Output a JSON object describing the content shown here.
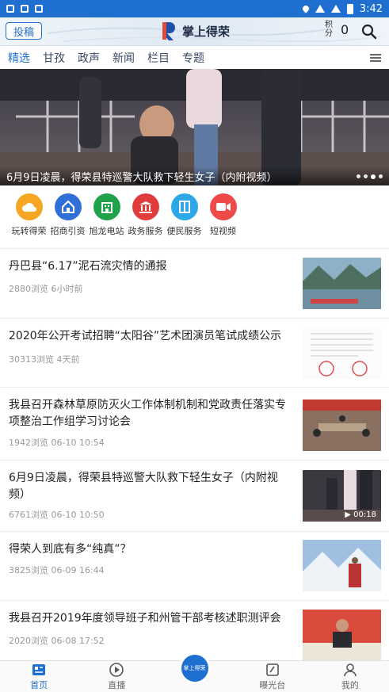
{
  "status_bar": {
    "time": "3:42"
  },
  "header": {
    "submit_label": "投稿",
    "app_name": "掌上得荣",
    "points_label": "积分",
    "points_value": "0"
  },
  "channels": [
    {
      "label": "精选",
      "active": true
    },
    {
      "label": "甘孜",
      "active": false
    },
    {
      "label": "政声",
      "active": false
    },
    {
      "label": "新闻",
      "active": false
    },
    {
      "label": "栏目",
      "active": false
    },
    {
      "label": "专题",
      "active": false
    }
  ],
  "banner": {
    "caption": "6月9日凌晨，得荣县特巡警大队救下轻生女子（内附视频）",
    "slide_count": 4,
    "active_slide": 3
  },
  "services": [
    {
      "label": "玩转得荣",
      "color": "#f5a623",
      "icon": "cloud-icon"
    },
    {
      "label": "招商引资",
      "color": "#2f6fd6",
      "icon": "home-icon"
    },
    {
      "label": "旭龙电站",
      "color": "#1fa24a",
      "icon": "building-icon"
    },
    {
      "label": "政务服务",
      "color": "#e03c3c",
      "icon": "government-icon"
    },
    {
      "label": "便民服务",
      "color": "#2ea7e6",
      "icon": "document-icon"
    },
    {
      "label": "短视频",
      "color": "#ef4a4a",
      "icon": "video-camera-icon"
    }
  ],
  "news": [
    {
      "title": "丹巴县“6.17”泥石流灾情的通报",
      "meta": "2880浏览 6小时前",
      "thumb": "river-valley-photo"
    },
    {
      "title": "2020年公开考试招聘“太阳谷”艺术团演员笔试成绩公示",
      "meta": "30313浏览 4天前",
      "thumb": "stamped-document-photo"
    },
    {
      "title": "我县召开森林草原防灭火工作体制机制和党政责任落实专项整治工作组学习讨论会",
      "meta": "1942浏览 06-10 10:54",
      "thumb": "meeting-room-photo"
    },
    {
      "title": "6月9日凌晨，得荣县特巡警大队救下轻生女子（内附视频）",
      "meta": "6761浏览 06-10 10:50",
      "thumb": "night-street-photo",
      "video_duration": "00:18"
    },
    {
      "title": "得荣人到底有多“纯真”？",
      "meta": "3825浏览 06-09 16:44",
      "thumb": "snow-mountain-photo"
    },
    {
      "title": "我县召开2019年度领导班子和州管干部考核述职测评会",
      "meta": "2020浏览 06-08 17:52",
      "thumb": "speaker-photo"
    }
  ],
  "tabs": [
    {
      "label": "首页",
      "icon": "home-list-icon",
      "active": true
    },
    {
      "label": "直播",
      "icon": "play-circle-icon",
      "active": false
    },
    {
      "label": "",
      "icon": "center-logo-icon",
      "active": false,
      "badge": "掌上得荣"
    },
    {
      "label": "曝光台",
      "icon": "edit-box-icon",
      "active": false
    },
    {
      "label": "我的",
      "icon": "person-icon",
      "active": false
    }
  ]
}
